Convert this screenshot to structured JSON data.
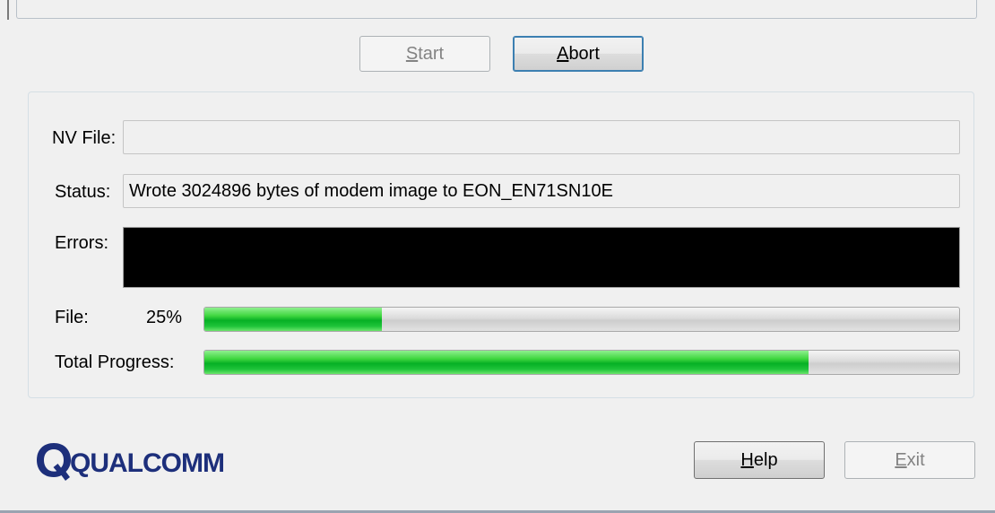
{
  "buttons": {
    "start": {
      "label_u": "S",
      "label_rest": "tart",
      "enabled": false
    },
    "abort": {
      "label_u": "A",
      "label_rest": "bort",
      "enabled": true
    },
    "help": {
      "label_u": "H",
      "label_rest": "elp",
      "enabled": true
    },
    "exit": {
      "label_u": "E",
      "label_rest": "xit",
      "enabled": false
    }
  },
  "nv_file": {
    "label": "NV File:",
    "value": ""
  },
  "status": {
    "label": "Status:",
    "value": "Wrote 3024896 bytes of modem image to EON_EN71SN10E"
  },
  "errors": {
    "label": "Errors:",
    "value": ""
  },
  "file_progress": {
    "label": "File:",
    "percent_text": "25%",
    "fraction": 0.235
  },
  "total_progress": {
    "label": "Total Progress:",
    "fraction": 0.8
  },
  "brand": {
    "name": "QUALCOMM",
    "color": "#1d2f7b"
  },
  "colors": {
    "progress_green": "#06b025",
    "errors_bg": "#000000"
  }
}
